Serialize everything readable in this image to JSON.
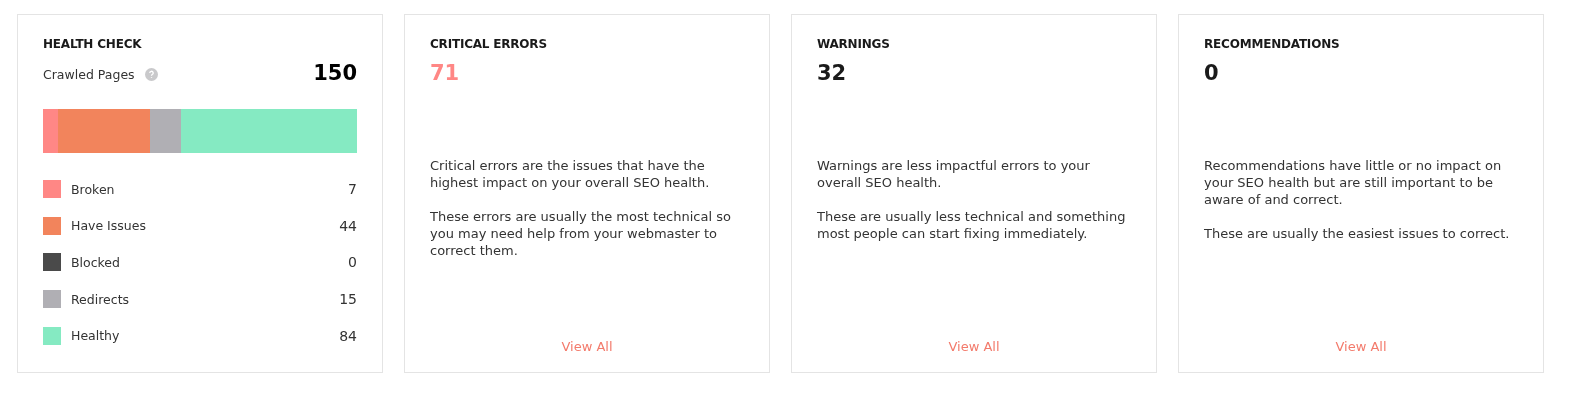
{
  "health_check": {
    "title": "HEALTH CHECK",
    "crawled_label": "Crawled Pages",
    "crawled_count": "150",
    "legend": [
      {
        "label": "Broken",
        "count": "7",
        "color": "#ff8785"
      },
      {
        "label": "Have Issues",
        "count": "44",
        "color": "#f2845c"
      },
      {
        "label": "Blocked",
        "count": "0",
        "color": "#4a4a4a"
      },
      {
        "label": "Redirects",
        "count": "15",
        "color": "#b0afb4"
      },
      {
        "label": "Healthy",
        "count": "84",
        "color": "#85eac2"
      }
    ]
  },
  "issue_cards": [
    {
      "title": "CRITICAL ERRORS",
      "count": "71",
      "color": "#ff8785",
      "paragraphs": [
        "Critical errors are the issues that have the highest impact on your overall SEO health.",
        "These errors are usually the most technical so you may need help from your webmaster to correct them."
      ],
      "link": "View All"
    },
    {
      "title": "WARNINGS",
      "count": "32",
      "color": "#1a1a1a",
      "paragraphs": [
        "Warnings are less impactful errors to your overall SEO health.",
        "These are usually less technical and something most people can start fixing immediately."
      ],
      "link": "View All"
    },
    {
      "title": "RECOMMENDATIONS",
      "count": "0",
      "color": "#1a1a1a",
      "paragraphs": [
        "Recommendations have little or no impact on your SEO health but are still important to be aware of and correct.",
        "These are usually the easiest issues to correct."
      ],
      "link": "View All"
    }
  ]
}
